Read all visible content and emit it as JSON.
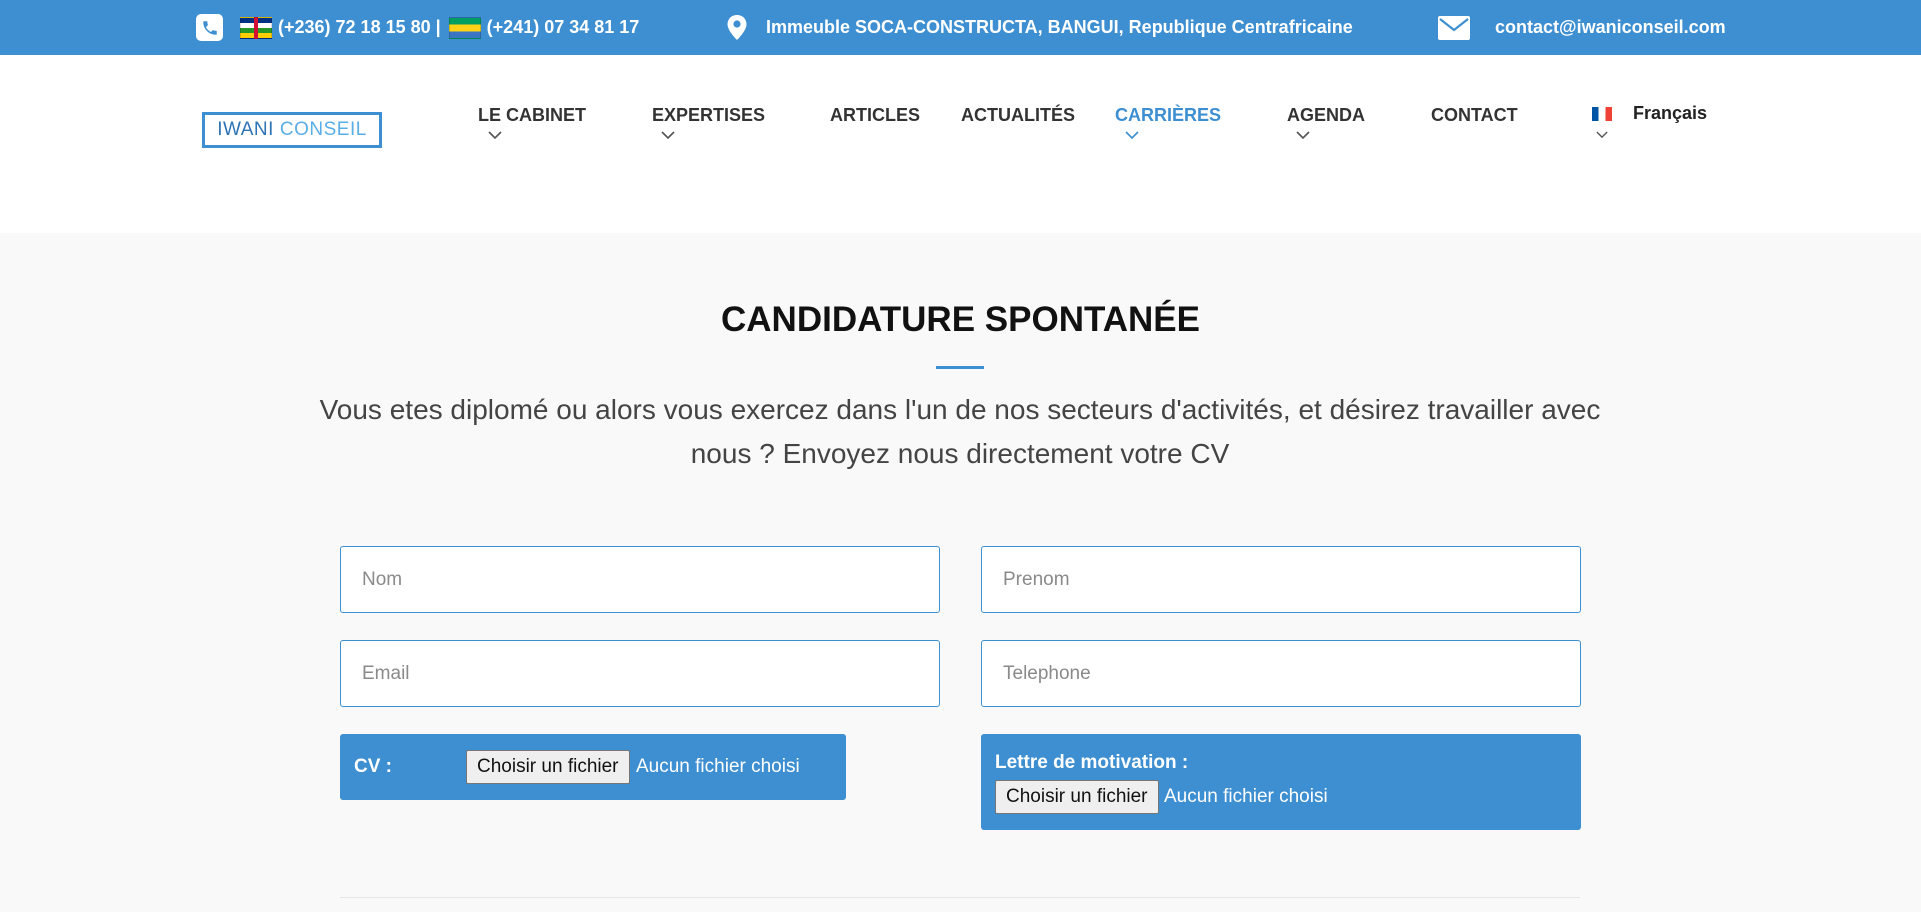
{
  "topbar": {
    "phone1": "(+236) 72 18 15 80 |",
    "phone2": "(+241) 07 34 81 17",
    "address": "Immeuble SOCA-CONSTRUCTA, BANGUI, Republique Centrafricaine",
    "email": "contact@iwaniconseil.com"
  },
  "logo": {
    "part1": "IWANI",
    "part2": "CONSEIL"
  },
  "nav": {
    "cabinet": "LE CABINET",
    "expertises": "EXPERTISES",
    "articles": "ARTICLES",
    "actualites": "ACTUALITÉS",
    "carrieres": "CARRIÈRES",
    "agenda": "AGENDA",
    "contact": "CONTACT",
    "language": "Français"
  },
  "main": {
    "title": "CANDIDATURE SPONTANÉE",
    "lead": "Vous etes diplomé ou alors vous exercez dans l'un de nos secteurs d'activités, et désirez travailler avec nous ? Envoyez nous directement votre CV"
  },
  "form": {
    "nom_placeholder": "Nom",
    "prenom_placeholder": "Prenom",
    "email_placeholder": "Email",
    "telephone_placeholder": "Telephone",
    "cv_label": "CV :",
    "lettre_label": "Lettre de motivation :",
    "file_button": "Choisir un fichier",
    "file_status": "Aucun fichier choisi"
  },
  "colors": {
    "accent": "#3d8fd1"
  }
}
